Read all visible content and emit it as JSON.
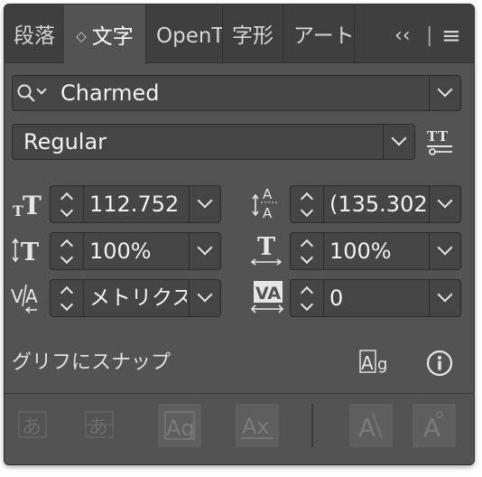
{
  "tabs": [
    {
      "label": "段落"
    },
    {
      "label": "文字",
      "indicator": "◇"
    },
    {
      "label": "OpenType"
    },
    {
      "label": "字形"
    },
    {
      "label": "アートボード"
    }
  ],
  "tabbar": {
    "collapse_icon": "‹‹",
    "separator": "|",
    "menu_icon": "≡"
  },
  "font_family": {
    "value": "Charmed"
  },
  "font_style": {
    "value": "Regular"
  },
  "fields": {
    "font_size": "112.752",
    "leading": "(135.302",
    "vertical_scale": "100%",
    "horizontal_scale": "100%",
    "kerning": "メトリクス",
    "tracking": "0"
  },
  "snap": {
    "label": "グリフにスナップ"
  },
  "bottom_icons": [
    "あ",
    "あ",
    "Ag",
    "Ax",
    "A",
    "A"
  ],
  "colors": {
    "panel": "#535353",
    "tabbar": "#3f3f3f",
    "field": "#454545",
    "text": "#f2f2f2"
  }
}
